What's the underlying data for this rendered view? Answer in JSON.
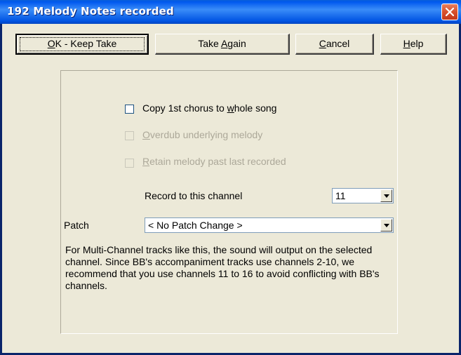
{
  "window": {
    "title": "192 Melody Notes recorded"
  },
  "buttons": {
    "ok": {
      "prefix": "",
      "accel": "O",
      "suffix": "K - Keep Take"
    },
    "take_again": {
      "prefix": "Take ",
      "accel": "A",
      "suffix": "gain"
    },
    "cancel": {
      "prefix": "",
      "accel": "C",
      "suffix": "ancel"
    },
    "help": {
      "prefix": "",
      "accel": "H",
      "suffix": "elp"
    }
  },
  "options": {
    "copy_chorus": {
      "pre": "Copy 1st chorus to ",
      "accel": "w",
      "post": "hole song",
      "checked": false,
      "enabled": true
    },
    "overdub": {
      "pre": "",
      "accel": "O",
      "post": "verdub underlying melody",
      "checked": false,
      "enabled": false
    },
    "retain": {
      "pre": "",
      "accel": "R",
      "post": "etain melody past last recorded",
      "checked": false,
      "enabled": false
    }
  },
  "channel": {
    "label": "Record to this channel",
    "value": "11"
  },
  "patch": {
    "label": "Patch",
    "value": "< No Patch Change >"
  },
  "info_text": "For Multi-Channel tracks like this, the sound will output on the selected channel. Since BB's accompaniment tracks use channels 2-10, we recommend that you use channels 11 to 16 to avoid conflicting with BB's channels.",
  "colors": {
    "titlebar": "#0054e3",
    "dialog_bg": "#ece9d8",
    "close": "#d8502c",
    "disabled_text": "#aca899"
  }
}
